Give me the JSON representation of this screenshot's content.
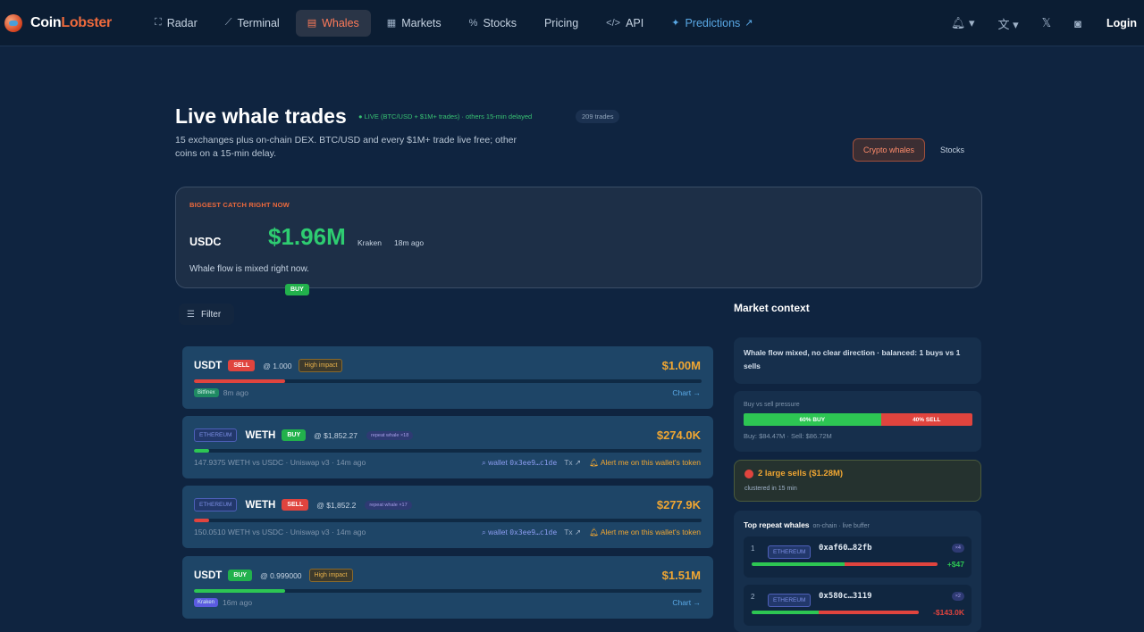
{
  "nav": {
    "brand_a": "Coin",
    "brand_b": "Lobster",
    "items": [
      {
        "label": "Radar",
        "icon": "radar-icon",
        "glyph": "⛶"
      },
      {
        "label": "Terminal",
        "icon": "line-chart-icon",
        "glyph": "⟋"
      },
      {
        "label": "Whales",
        "icon": "whale-icon",
        "glyph": "▤"
      },
      {
        "label": "Markets",
        "icon": "grid-icon",
        "glyph": "▦"
      },
      {
        "label": "Stocks",
        "icon": "stocks-icon",
        "glyph": "%"
      },
      {
        "label": "Pricing",
        "icon": "",
        "glyph": ""
      },
      {
        "label": "API",
        "icon": "code-icon",
        "glyph": "</>"
      },
      {
        "label": "Predictions",
        "icon": "predictions-icon",
        "glyph": "✦",
        "ext": "↗"
      }
    ],
    "login": "Login"
  },
  "header": {
    "title": "Live whale trades",
    "live_note": "● LIVE (BTC/USD + $1M+ trades) · others 15-min delayed",
    "trade_count": "209 trades",
    "subtitle": "15 exchanges plus on-chain DEX. BTC/USD and every $1M+ trade live free; other coins on a 15-min delay.",
    "tabs": [
      "Crypto whales",
      "Stocks"
    ]
  },
  "catch": {
    "kicker": "BIGGEST CATCH RIGHT NOW",
    "symbol": "USDC",
    "side": "BUY",
    "amount": "$1.96M",
    "exchange": "Kraken",
    "ago": "18m ago",
    "flow": "Whale flow is mixed right now."
  },
  "filter": {
    "label": "Filter"
  },
  "trades": [
    {
      "chain": "",
      "token": "USDT",
      "side": "SELL",
      "price": "@ 1.000",
      "impact": "High impact",
      "repeat": "",
      "amount": "$1.00M",
      "bar_fraction": 0.18,
      "bar_color": "#e0443e",
      "exchange": "Bitfinex",
      "exchange_color": "#1f8a63",
      "meta": "8m ago",
      "link": "Chart →",
      "wallet_label": "",
      "wallet": "",
      "tx": "",
      "alert": ""
    },
    {
      "chain": "ETHEREUM",
      "token": "WETH",
      "side": "BUY",
      "price": "@ $1,852.27",
      "impact": "",
      "repeat": "repeat whale ×18",
      "amount": "$274.0K",
      "bar_fraction": 0.03,
      "bar_color": "#2dc653",
      "exchange": "",
      "exchange_color": "",
      "meta": "147.9375 WETH vs USDC · Uniswap v3 · 14m ago",
      "link": "",
      "wallet_label": "wallet",
      "wallet": "0x3ee9…c1de",
      "tx": "Tx ↗",
      "alert": "Alert me on this wallet's token"
    },
    {
      "chain": "ETHEREUM",
      "token": "WETH",
      "side": "SELL",
      "price": "@ $1,852.2",
      "impact": "",
      "repeat": "repeat whale ×17",
      "amount": "$277.9K",
      "bar_fraction": 0.03,
      "bar_color": "#e0443e",
      "exchange": "",
      "exchange_color": "",
      "meta": "150.0510 WETH vs USDC · Uniswap v3 · 14m ago",
      "link": "",
      "wallet_label": "wallet",
      "wallet": "0x3ee9…c1de",
      "tx": "Tx ↗",
      "alert": "Alert me on this wallet's token"
    },
    {
      "chain": "",
      "token": "USDT",
      "side": "BUY",
      "price": "@ 0.999000",
      "impact": "High impact",
      "repeat": "",
      "amount": "$1.51M",
      "bar_fraction": 0.18,
      "bar_color": "#2dc653",
      "exchange": "Kraken",
      "exchange_color": "#5b5be0",
      "meta": "16m ago",
      "link": "Chart →",
      "wallet_label": "",
      "wallet": "",
      "tx": "",
      "alert": ""
    }
  ],
  "market": {
    "title": "Market context",
    "summary": "Whale flow mixed, no clear direction · balanced: 1 buys vs 1 sells",
    "pressure_label": "Buy vs sell pressure",
    "buy_fraction": 0.6,
    "buy_label": "60% BUY",
    "sell_label": "40% SELL",
    "totals": "Buy: $84.47M · Sell: $86.72M",
    "alert_head": "2 large sells ($1.28M)",
    "alert_sub": "clustered in 15 min",
    "repeat_title": "Top repeat whales",
    "repeat_sub": "on-chain · live buffer",
    "repeat_rows": [
      {
        "rank": "1",
        "chain": "ETHEREUM",
        "addr": "0xaf60…82fb",
        "count": "×4",
        "net": "+$47",
        "net_color": "#2dc653",
        "buy_fraction": 0.5
      },
      {
        "rank": "2",
        "chain": "ETHEREUM",
        "addr": "0x580c…3119",
        "count": "×2",
        "net": "-$143.0K",
        "net_color": "#e0443e",
        "buy_fraction": 0.4
      }
    ]
  },
  "colors": {
    "accent": "#ef6a3c",
    "buy": "#22b14c",
    "sell": "#e0443e",
    "amount": "#f0a632",
    "background": "#0f2440"
  }
}
